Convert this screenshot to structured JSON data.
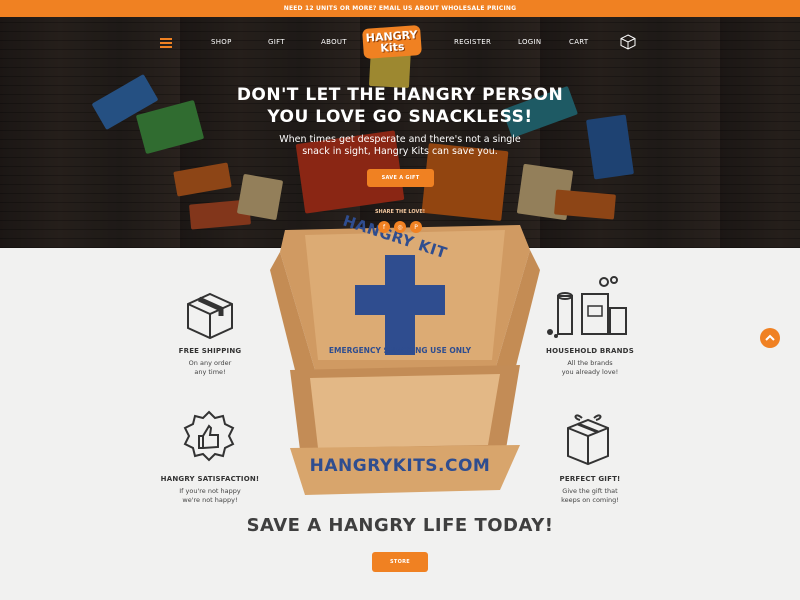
{
  "announcement": "Need 12 units or more? Email us about wholesale pricing",
  "nav": {
    "shop": "SHOP",
    "gift": "GIFT",
    "about": "ABOUT",
    "register": "REGISTER",
    "login": "LOGIN",
    "cart": "CART",
    "logo_top": "HANGRY",
    "logo_bottom": "Kits"
  },
  "hero": {
    "headline_line1": "DON'T LET THE HANGRY PERSON",
    "headline_line2": "YOU LOVE GO SNACKLESS!",
    "subtext": "When times get desperate and there's not a single snack in sight, Hangry Kits can save you.",
    "cta": "SAVE A GIFT"
  },
  "share": {
    "label": "SHARE THE LOVE!",
    "icons": [
      "facebook-icon",
      "instagram-icon",
      "pinterest-icon"
    ]
  },
  "box": {
    "brand": "HANGRY KIT",
    "tagline": "EMERGENCY SNACKING USE ONLY",
    "url": "HANGRYKITS.COM"
  },
  "features": {
    "shipping": {
      "title": "FREE SHIPPING",
      "desc1": "On any order",
      "desc2": "any time!"
    },
    "brands": {
      "title": "HOUSEHOLD BRANDS",
      "desc1": "All the brands",
      "desc2": "you already love!"
    },
    "satisfaction": {
      "title": "HANGRY SATISFACTION!",
      "desc1": "If you're not happy",
      "desc2": "we're not happy!"
    },
    "gift": {
      "title": "PERFECT GIFT!",
      "desc1": "Give the gift that",
      "desc2": "keeps on coming!"
    }
  },
  "bottom": {
    "title": "SAVE A HANGRY LIFE TODAY!",
    "cta": "STORE"
  },
  "colors": {
    "accent": "#f08122",
    "box": "#d9a66c",
    "print": "#2f4d8f"
  }
}
